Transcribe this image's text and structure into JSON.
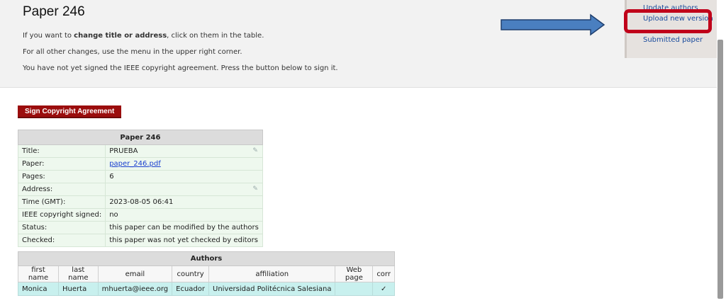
{
  "page": {
    "title": "Paper 246",
    "line1_prefix": "If you want to ",
    "line1_bold": "change title or address",
    "line1_suffix": ", click on them in the table.",
    "line2": "For all other changes, use the menu in the upper right corner.",
    "line3": "You have not yet signed the IEEE copyright agreement. Press the button below to sign it."
  },
  "menu": {
    "items": [
      "Update authors",
      "Upload new version",
      "Submitted paper"
    ]
  },
  "annotations": {
    "arrow_color": "#4a7fc0",
    "highlight_color": "#c0001a"
  },
  "sign_button": {
    "label": "Sign Copyright Agreement"
  },
  "paper_table": {
    "caption": "Paper 246",
    "rows": [
      {
        "label": "Title:",
        "value": "PRUEBA"
      },
      {
        "label": "Paper:",
        "value": "paper_246.pdf"
      },
      {
        "label": "Pages:",
        "value": "6"
      },
      {
        "label": "Address:",
        "value": ""
      },
      {
        "label": "Time (GMT):",
        "value": "2023-08-05 06:41"
      },
      {
        "label": "IEEE copyright signed:",
        "value": "no"
      },
      {
        "label": "Status:",
        "value": "this paper can be modified by the authors"
      },
      {
        "label": "Checked:",
        "value": "this paper was not yet checked by editors"
      }
    ]
  },
  "authors_table": {
    "caption": "Authors",
    "columns": [
      "first name",
      "last name",
      "email",
      "country",
      "affiliation",
      "Web page",
      "corr"
    ],
    "rows": [
      {
        "first_name": "Monica",
        "last_name": "Huerta",
        "email": "mhuerta@ieee.org",
        "country": "Ecuador",
        "affiliation": "Universidad Politécnica Salesiana",
        "web_page": "",
        "corr": "✓"
      }
    ]
  }
}
